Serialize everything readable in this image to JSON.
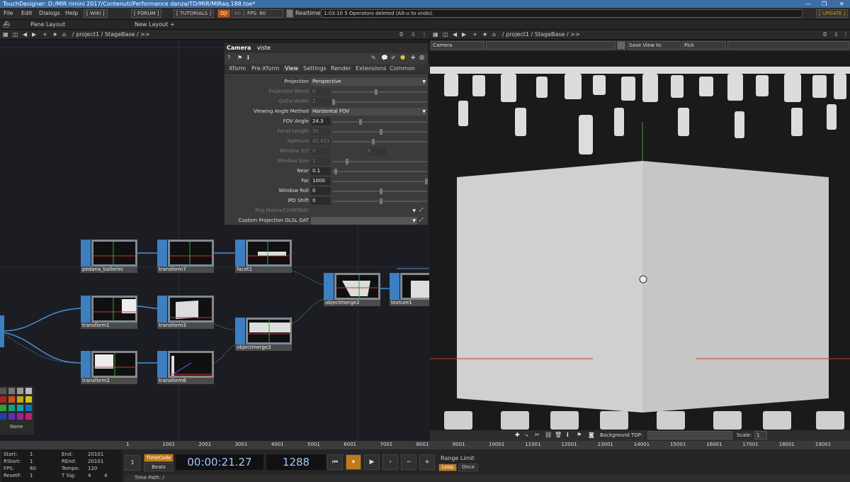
{
  "window": {
    "title": "TouchDesigner: D:/MIR rimini 2017/Contenuti/Performance danza/TD/MIR/MIRaq.188.toe*"
  },
  "menu": {
    "items": [
      "File",
      "Edit",
      "Dialogs",
      "Help"
    ],
    "wiki": "[ WIKI ]",
    "forum": "[ FORUM ]",
    "tutorials": "[ TUTORIALS ]",
    "oi": "O|I",
    "fps_target": "60",
    "fps": "FPS:  60",
    "realtime": "Realtime",
    "status": "1:03:10 5 Operators deleted (Alt-u to undo).",
    "update": "[ UPDATE ]"
  },
  "tabbar": {
    "pane_layout": "Pane Layout",
    "new_layout": "New Layout",
    "plus": "+"
  },
  "left_pane": {
    "path": "/ project1 / StageBase / >>",
    "zero": "0"
  },
  "right_pane": {
    "path": "/ project1 / StageBase / >>",
    "zero": "0"
  },
  "params": {
    "op_type": "Camera",
    "op_name": "viste",
    "tabs": [
      "Xform",
      "Pre-Xform",
      "View",
      "Settings",
      "Render",
      "Extensions",
      "Common"
    ],
    "rows": [
      {
        "label": "Projection",
        "value": "Perspective",
        "kind": "menu",
        "dim": false
      },
      {
        "label": "Projection Blend",
        "value": "0",
        "kind": "slider",
        "dim": true
      },
      {
        "label": "Ortho Width",
        "value": "2",
        "kind": "slider",
        "dim": true
      },
      {
        "label": "Viewing Angle Method",
        "value": "Horizontal FOV",
        "kind": "menu",
        "dim": false
      },
      {
        "label": "FOV Angle",
        "value": "24.3",
        "kind": "slider",
        "dim": false
      },
      {
        "label": "Focal Length",
        "value": "50",
        "kind": "slider",
        "dim": true
      },
      {
        "label": "Aperture",
        "value": "41.421",
        "kind": "slider",
        "dim": true
      },
      {
        "label": "Window X/Y",
        "value": "0",
        "value2": "0",
        "kind": "pair",
        "dim": true
      },
      {
        "label": "Window Size",
        "value": "1",
        "kind": "slider",
        "dim": true
      },
      {
        "label": "Near",
        "value": "0.1",
        "kind": "slider",
        "dim": false
      },
      {
        "label": "Far",
        "value": "1000",
        "kind": "slider",
        "dim": false
      },
      {
        "label": "Window Roll",
        "value": "0",
        "kind": "slider",
        "dim": false
      },
      {
        "label": "IPD Shift",
        "value": "0",
        "kind": "slider",
        "dim": false
      },
      {
        "label": "Proj Matrix/CHOP/DAT",
        "value": "",
        "kind": "field",
        "dim": true
      },
      {
        "label": "Custom Projection GLSL DAT",
        "value": "",
        "kind": "field",
        "dim": false
      }
    ]
  },
  "nodes": [
    {
      "name": "pedana_ballerini"
    },
    {
      "name": "transform7"
    },
    {
      "name": "facet1"
    },
    {
      "name": "objectmerge2"
    },
    {
      "name": "texture1"
    },
    {
      "name": "transform1"
    },
    {
      "name": "transform3"
    },
    {
      "name": "objectmerge3"
    },
    {
      "name": "transform2"
    },
    {
      "name": "transform6"
    }
  ],
  "viewer": {
    "camera": "Camera",
    "save_view": "Save View to",
    "pick": "Pick",
    "bg_label": "Background TOP:",
    "scale_label": "Scale:",
    "scale": "1"
  },
  "palette": {
    "none_label": "None"
  },
  "timeline": {
    "ticks": [
      "1",
      "1001",
      "2001",
      "3001",
      "4001",
      "5001",
      "6001",
      "7001",
      "8001",
      "9001",
      "10001",
      "11001",
      "12001",
      "13001",
      "14001",
      "15001",
      "16001",
      "17001",
      "18001",
      "19001"
    ]
  },
  "info": {
    "start_l": "Start:",
    "start_v": "1",
    "end_l": "End:",
    "end_v": "20101",
    "rstart_l": "RStart:",
    "rstart_v": "1",
    "rend_l": "REnd:",
    "rend_v": "20101",
    "fps_l": "FPS:",
    "fps_v": "60",
    "tempo_l": "Tempo:",
    "tempo_v": "120",
    "resetf_l": "ResetF:",
    "resetf_v": "1",
    "tsig_l": "T Sig:",
    "tsig_v1": "4",
    "tsig_v2": "4"
  },
  "transport": {
    "timecode": "TimeCode",
    "beats": "Beats",
    "time": "00:00:21.27",
    "frame": "1288",
    "range_limit": "Range Limit",
    "loop": "Loop",
    "once": "Once",
    "time_path": "Time Path: /",
    "one": "1"
  }
}
